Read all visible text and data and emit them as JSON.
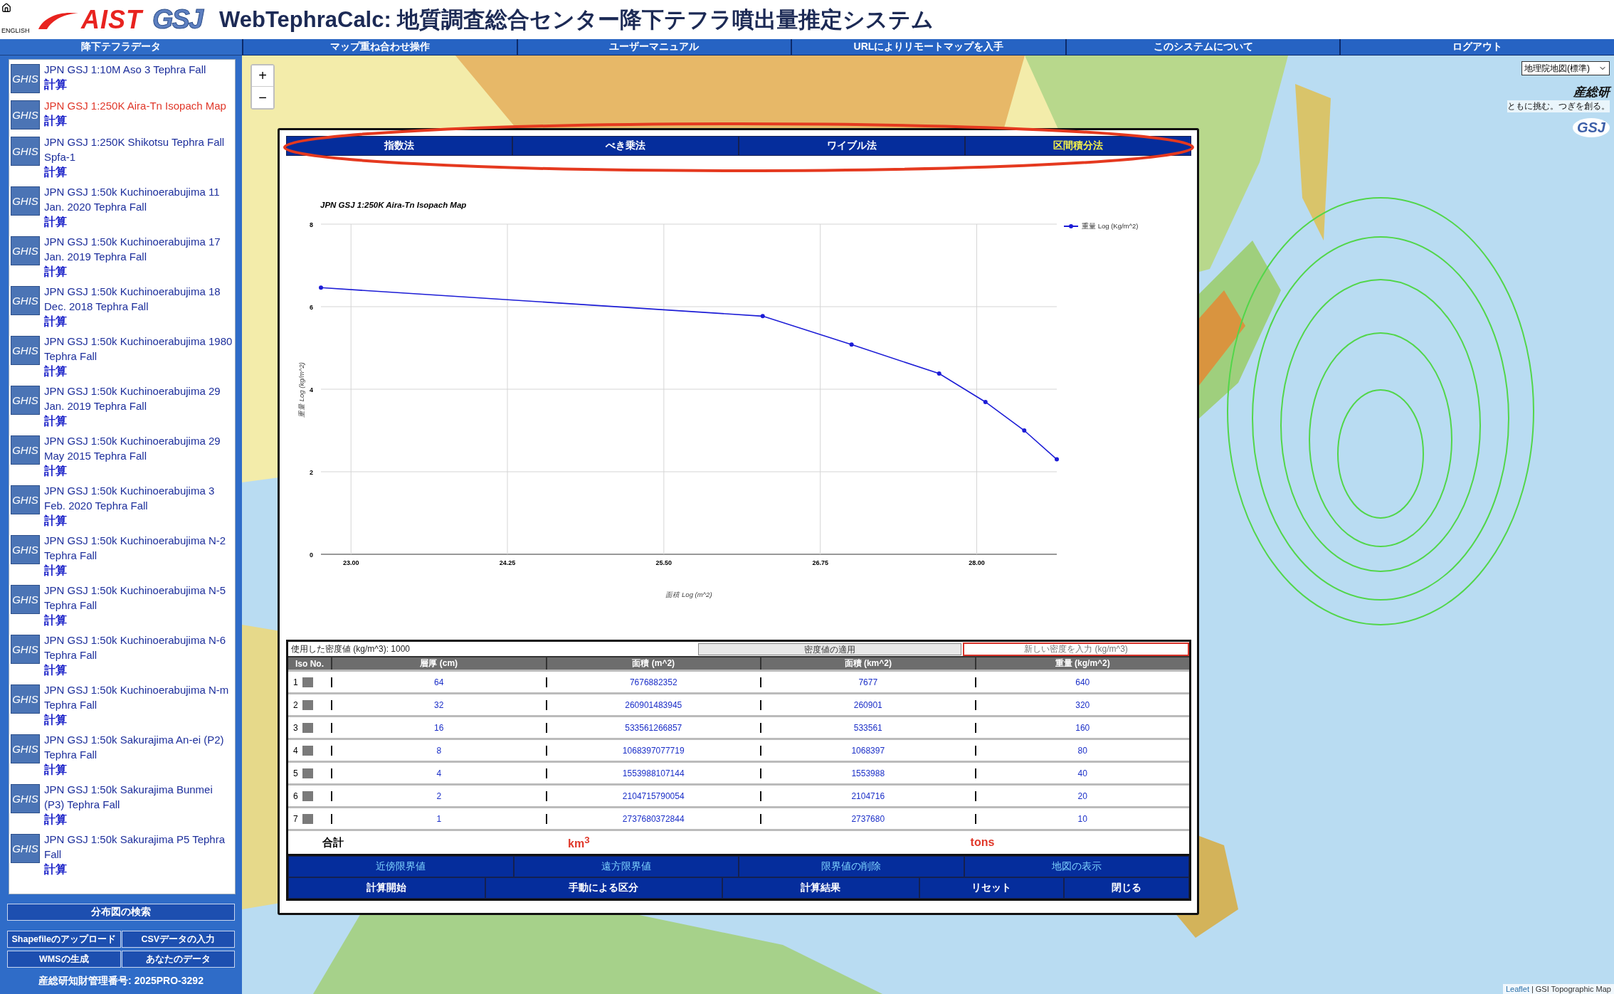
{
  "header": {
    "home_label": "ENGLISH",
    "logos": [
      {
        "kind": "aist",
        "text": "AIST"
      },
      {
        "kind": "gsj",
        "text": "GSJ"
      }
    ],
    "title": "WebTephraCalc: 地質調査総合センター降下テフラ噴出量推定システム"
  },
  "sidebar": {
    "title": "降下テフラデータ",
    "items": [
      {
        "badge": "GHIS",
        "title": "JPN GSJ 1:10M Aso 3 Tephra Fall",
        "action": "計算",
        "selected": false
      },
      {
        "badge": "GHIS",
        "title": "JPN GSJ 1:250K Aira-Tn Isopach Map",
        "action": "計算",
        "selected": true
      },
      {
        "badge": "GHIS",
        "title": "JPN GSJ 1:250K Shikotsu Tephra Fall Spfa-1",
        "action": "計算",
        "selected": false
      },
      {
        "badge": "GHIS",
        "title": "JPN GSJ 1:50k Kuchinoerabujima 11 Jan. 2020 Tephra Fall",
        "action": "計算",
        "selected": false
      },
      {
        "badge": "GHIS",
        "title": "JPN GSJ 1:50k Kuchinoerabujima 17 Jan. 2019 Tephra Fall",
        "action": "計算",
        "selected": false
      },
      {
        "badge": "GHIS",
        "title": "JPN GSJ 1:50k Kuchinoerabujima 18 Dec. 2018 Tephra Fall",
        "action": "計算",
        "selected": false
      },
      {
        "badge": "GHIS",
        "title": "JPN GSJ 1:50k Kuchinoerabujima 1980 Tephra Fall",
        "action": "計算",
        "selected": false
      },
      {
        "badge": "GHIS",
        "title": "JPN GSJ 1:50k Kuchinoerabujima 29 Jan. 2019 Tephra Fall",
        "action": "計算",
        "selected": false
      },
      {
        "badge": "GHIS",
        "title": "JPN GSJ 1:50k Kuchinoerabujima 29 May 2015 Tephra Fall",
        "action": "計算",
        "selected": false
      },
      {
        "badge": "GHIS",
        "title": "JPN GSJ 1:50k Kuchinoerabujima 3 Feb. 2020 Tephra Fall",
        "action": "計算",
        "selected": false
      },
      {
        "badge": "GHIS",
        "title": "JPN GSJ 1:50k Kuchinoerabujima N-2 Tephra Fall",
        "action": "計算",
        "selected": false
      },
      {
        "badge": "GHIS",
        "title": "JPN GSJ 1:50k Kuchinoerabujima N-5 Tephra Fall",
        "action": "計算",
        "selected": false
      },
      {
        "badge": "GHIS",
        "title": "JPN GSJ 1:50k Kuchinoerabujima N-6 Tephra Fall",
        "action": "計算",
        "selected": false
      },
      {
        "badge": "GHIS",
        "title": "JPN GSJ 1:50k Kuchinoerabujima N-m Tephra Fall",
        "action": "計算",
        "selected": false
      },
      {
        "badge": "GHIS",
        "title": "JPN GSJ 1:50k Sakurajima An-ei (P2) Tephra Fall",
        "action": "計算",
        "selected": false
      },
      {
        "badge": "GHIS",
        "title": "JPN GSJ 1:50k Sakurajima Bunmei (P3) Tephra Fall",
        "action": "計算",
        "selected": false
      },
      {
        "badge": "GHIS",
        "title": "JPN GSJ 1:50k Sakurajima P5 Tephra Fall",
        "action": "計算",
        "selected": false
      }
    ],
    "search_button": "分布図の検索",
    "buttons": [
      "Shapefileのアップロード",
      "CSVデータの入力",
      "WMSの生成",
      "あなたのデータ"
    ],
    "footer": "産総研知財管理番号: 2025PRO-3292"
  },
  "nav": [
    "マップ重ね合わせ操作",
    "ユーザーマニュアル",
    "URLによりリモートマップを入手",
    "このシステムについて",
    "ログアウト"
  ],
  "map": {
    "kind": "picture",
    "zoom_in": "+",
    "zoom_out": "−",
    "layer_select": "地理院地図(標準)",
    "brand": {
      "name": "産総研",
      "tagline": "ともに挑む。つぎを創る。",
      "logo": "GSJ"
    },
    "attribution": {
      "link": "Leaflet",
      "separator": "|",
      "text": "GSI Topographic Map"
    }
  },
  "dialog": {
    "highlight_tabs": true,
    "tabs": [
      {
        "label": "指数法",
        "selected": false
      },
      {
        "label": "べき乗法",
        "selected": false
      },
      {
        "label": "ワイブル法",
        "selected": false
      },
      {
        "label": "区間積分法",
        "selected": true
      }
    ],
    "chart_data": {
      "type": "line",
      "title": "JPN GSJ 1:250K Aira-Tn Isopach Map",
      "xlabel": "面積 Log (m^2)",
      "ylabel": "重量 Log (kg/m^2)",
      "x": [
        22.76,
        26.29,
        27.0,
        27.7,
        28.07,
        28.38,
        28.64
      ],
      "grid": true,
      "series": [
        {
          "name": "重量 Log (Kg/m^2)",
          "color": "#1c1cd6",
          "marker": "circle",
          "values": [
            6.46,
            5.77,
            5.08,
            4.38,
            3.69,
            3.0,
            2.3
          ]
        }
      ],
      "xlim": [
        22.76,
        28.64
      ],
      "ylim": [
        0,
        8
      ],
      "xticks": [
        {
          "value": 23,
          "label": "23.00"
        },
        {
          "value": 24.25,
          "label": "24.25"
        },
        {
          "value": 25.5,
          "label": "25.50"
        },
        {
          "value": 26.75,
          "label": "26.75"
        },
        {
          "value": 28,
          "label": "28.00"
        }
      ],
      "yticks": [
        0,
        2,
        4,
        6,
        8
      ]
    },
    "density": {
      "label": "使用した密度値 (kg/m^3): 1000",
      "apply": "密度値の適用",
      "placeholder": "新しい密度を入力 (kg/m^3)"
    },
    "table": {
      "columns": [
        "Iso No.",
        "層厚 (cm)",
        "面積 (m^2)",
        "面積 (km^2)",
        "重量 (kg/m^2)"
      ],
      "rows": [
        {
          "iso": "1",
          "thickness": "64",
          "area_m2": "7676882352",
          "area_km2": "7677",
          "weight": "640"
        },
        {
          "iso": "2",
          "thickness": "32",
          "area_m2": "260901483945",
          "area_km2": "260901",
          "weight": "320"
        },
        {
          "iso": "3",
          "thickness": "16",
          "area_m2": "533561266857",
          "area_km2": "533561",
          "weight": "160"
        },
        {
          "iso": "4",
          "thickness": "8",
          "area_m2": "1068397077719",
          "area_km2": "1068397",
          "weight": "80"
        },
        {
          "iso": "5",
          "thickness": "4",
          "area_m2": "1553988107144",
          "area_km2": "1553988",
          "weight": "40"
        },
        {
          "iso": "6",
          "thickness": "2",
          "area_m2": "2104715790054",
          "area_km2": "2104716",
          "weight": "20"
        },
        {
          "iso": "7",
          "thickness": "1",
          "area_m2": "2737680372844",
          "area_km2": "2737680",
          "weight": "10"
        }
      ],
      "total": {
        "label": "合計",
        "volume": "km$^{3}$",
        "mass": "tons"
      }
    },
    "actions_1": [
      "近傍限界値",
      "遠方限界値",
      "限界値の削除",
      "地図の表示"
    ],
    "actions_2": [
      "計算開始",
      "手動による区分",
      "計算結果",
      "リセット",
      "閉じる"
    ]
  }
}
